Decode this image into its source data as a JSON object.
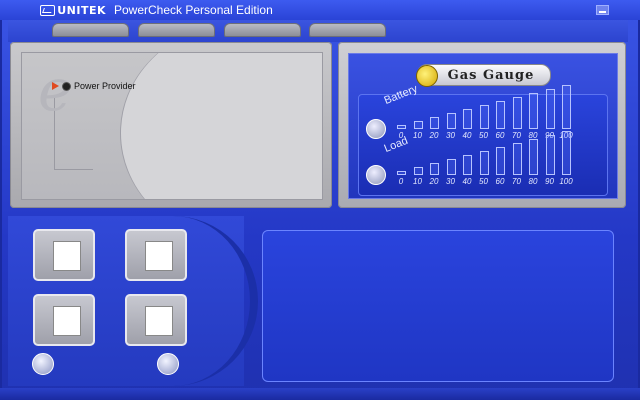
{
  "window": {
    "logo_text": "UNITEK",
    "title": "PowerCheck Personal Edition"
  },
  "power": {
    "provider_label": "Power Provider"
  },
  "gauge": {
    "title": "Gas Gauge",
    "battery_label": "Battery",
    "load_label": "Load",
    "scale": [
      "0",
      "10",
      "20",
      "30",
      "40",
      "50",
      "60",
      "70",
      "80",
      "90",
      "100"
    ]
  },
  "icons": {
    "minimize": "minimize-icon",
    "power_provider": "power-plug-icon",
    "battery": "battery-icon",
    "load": "load-icon",
    "computer": "computer-icon",
    "cube": "cube-icon"
  },
  "colors": {
    "accent": "#2a43d6",
    "panel_grey": "#c6c6c9",
    "gauge_bg": "#2136bd"
  }
}
